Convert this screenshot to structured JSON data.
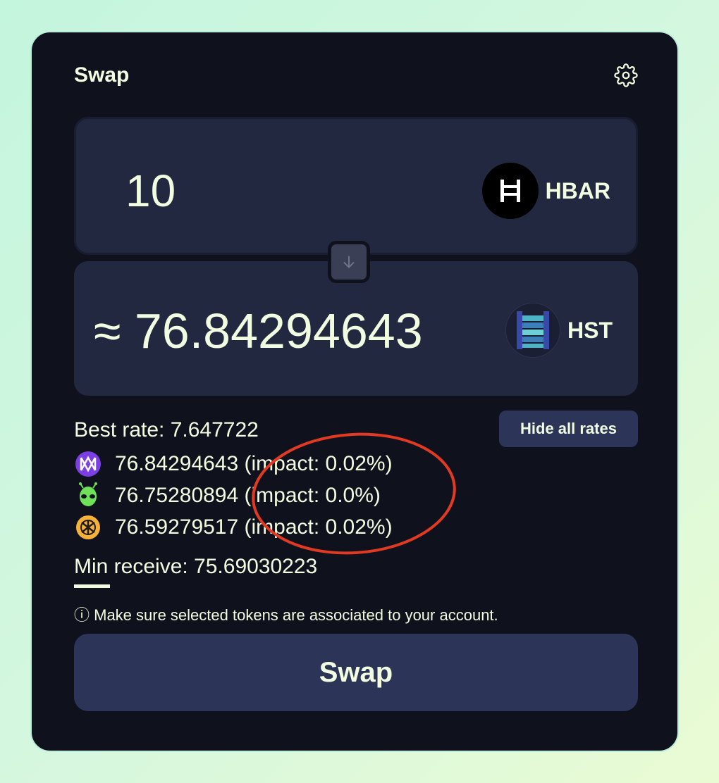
{
  "header": {
    "title": "Swap",
    "settings_icon": "gear-icon"
  },
  "from": {
    "amount": "10",
    "token": "HBAR",
    "token_icon": "hedera-logo"
  },
  "switch_icon": "arrow-down-icon",
  "to": {
    "amount": "≈ 76.84294643",
    "token": "HST",
    "token_icon": "hst-logo"
  },
  "rates": {
    "best_rate": "Best rate: 7.647722",
    "toggle_label": "Hide all rates",
    "items": [
      {
        "icon": "purple-dex-icon",
        "text": "76.84294643 (impact: 0.02%)"
      },
      {
        "icon": "alien-icon",
        "text": "76.75280894 (impact: 0.0%)"
      },
      {
        "icon": "orange-dex-icon",
        "text": "76.59279517 (impact: 0.02%)"
      }
    ]
  },
  "min_receive": "Min receive: 75.69030223",
  "notice": "ⓘ Make sure selected tokens are associated to your account.",
  "swap_button": "Swap",
  "colors": {
    "card": "#0f121d",
    "panel": "#232841",
    "button": "#2c3558",
    "text": "#f2fce0",
    "annotation": "#e23a22"
  }
}
